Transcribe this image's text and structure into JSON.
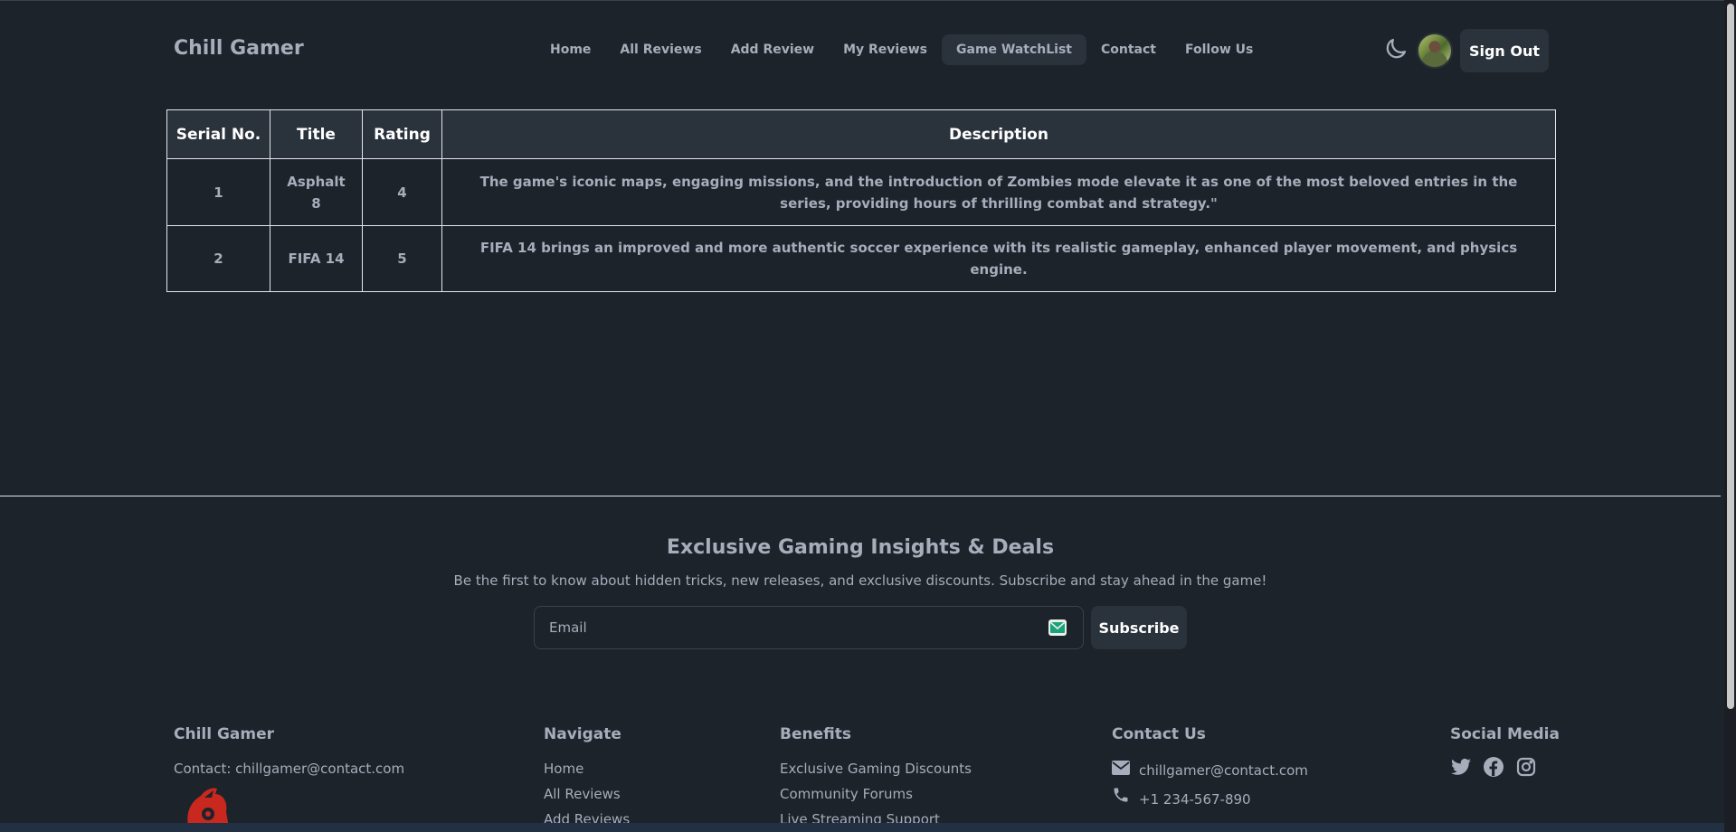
{
  "brand": "Chill Gamer",
  "nav": {
    "links": [
      "Home",
      "All Reviews",
      "Add Review",
      "My Reviews",
      "Game WatchList",
      "Contact",
      "Follow Us"
    ],
    "active": "Game WatchList",
    "signout_label": "Sign Out"
  },
  "table": {
    "headers": [
      "Serial No.",
      "Title",
      "Rating",
      "Description"
    ],
    "rows": [
      [
        "1",
        "Asphalt 8",
        "4",
        "The game's iconic maps, engaging missions, and the introduction of Zombies mode elevate it as one of the most beloved entries in the series, providing hours of thrilling combat and strategy.\""
      ],
      [
        "2",
        "FIFA 14",
        "5",
        "FIFA 14 brings an improved and more authentic soccer experience with its realistic gameplay, enhanced player movement, and physics engine."
      ]
    ]
  },
  "newsletter": {
    "title": "Exclusive Gaming Insights & Deals",
    "subtitle": "Be the first to know about hidden tricks, new releases, and exclusive discounts. Subscribe and stay ahead in the game!",
    "email_placeholder": "Email",
    "subscribe_label": "Subscribe"
  },
  "footer": {
    "about": {
      "title": "Chill Gamer",
      "contact": "Contact: chillgamer@contact.com"
    },
    "navigate": {
      "title": "Navigate",
      "items": [
        "Home",
        "All Reviews",
        "Add Reviews"
      ]
    },
    "benefits": {
      "title": "Benefits",
      "items": [
        "Exclusive Gaming Discounts",
        "Community Forums",
        "Live Streaming Support"
      ]
    },
    "contact": {
      "title": "Contact Us",
      "email": "chillgamer@contact.com",
      "phone": "+1 234-567-890"
    },
    "social": {
      "title": "Social Media",
      "icons": [
        "twitter-icon",
        "facebook-icon",
        "instagram-icon"
      ]
    }
  },
  "colors": {
    "background": "#1d232a",
    "surface": "#2a323c",
    "text": "#a6adbb"
  }
}
